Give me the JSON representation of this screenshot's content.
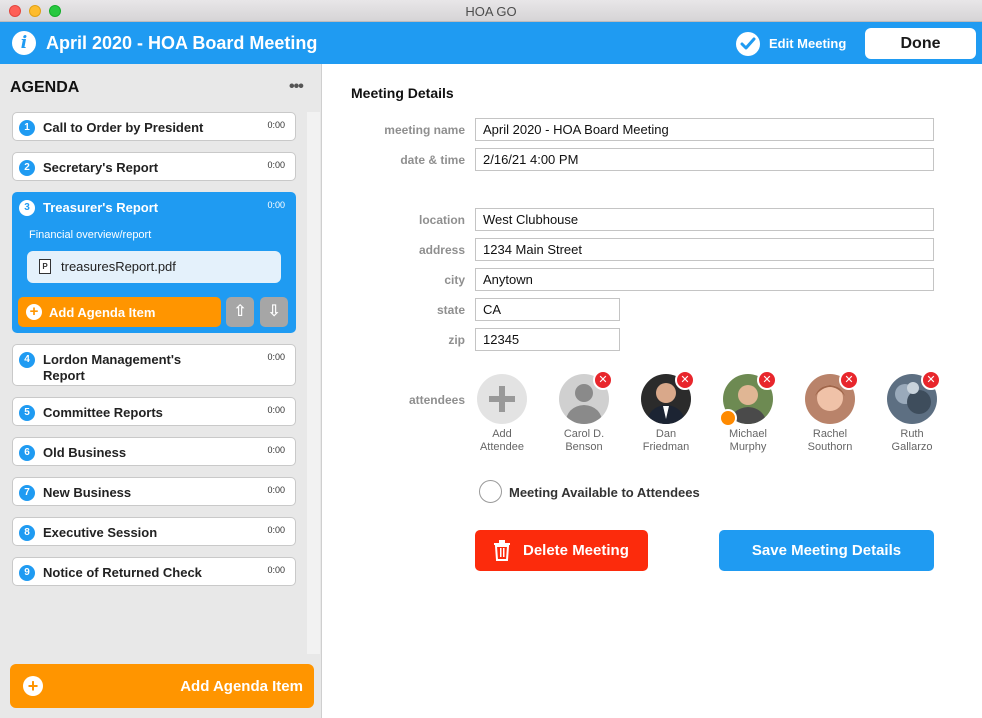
{
  "window": {
    "title": "HOA GO"
  },
  "header": {
    "title": "April 2020 - HOA Board Meeting",
    "edit_label": "Edit Meeting",
    "done_label": "Done",
    "accent": "#1f9bf2"
  },
  "sidebar": {
    "heading": "AGENDA",
    "items": [
      {
        "num": "1",
        "label": "Call to Order by President",
        "duration": "0:00"
      },
      {
        "num": "2",
        "label": "Secretary's Report",
        "duration": "0:00"
      },
      {
        "num": "3",
        "label": "Treasurer's Report",
        "duration": "0:00",
        "description": "Financial overview/report",
        "attachment": "treasuresReport.pdf",
        "add_label": "Add Agenda Item"
      },
      {
        "num": "4",
        "label": "Lordon Management's Report",
        "duration": "0:00"
      },
      {
        "num": "5",
        "label": "Committee Reports",
        "duration": "0:00"
      },
      {
        "num": "6",
        "label": "Old Business",
        "duration": "0:00"
      },
      {
        "num": "7",
        "label": "New Business",
        "duration": "0:00"
      },
      {
        "num": "8",
        "label": "Executive Session",
        "duration": "0:00"
      },
      {
        "num": "9",
        "label": "Notice of Returned Check",
        "duration": "0:00"
      }
    ],
    "add_button": "Add Agenda Item",
    "add_color": "#ff9500"
  },
  "details": {
    "heading": "Meeting Details",
    "fields": {
      "meeting_name": {
        "label": "meeting name",
        "value": "April 2020 - HOA Board Meeting"
      },
      "date_time": {
        "label": "date & time",
        "value": "2/16/21 4:00 PM"
      },
      "location": {
        "label": "location",
        "value": "West Clubhouse"
      },
      "address": {
        "label": "address",
        "value": "1234 Main Street"
      },
      "city": {
        "label": "city",
        "value": "Anytown"
      },
      "state": {
        "label": "state",
        "value": "CA"
      },
      "zip": {
        "label": "zip",
        "value": "12345"
      }
    },
    "attendees_label": "attendees",
    "add_attendee": {
      "line1": "Add",
      "line2": "Attendee"
    },
    "attendees": [
      {
        "first": "Carol D.",
        "last": "Benson"
      },
      {
        "first": "Dan",
        "last": "Friedman"
      },
      {
        "first": "Michael",
        "last": "Murphy"
      },
      {
        "first": "Rachel",
        "last": "Southorn"
      },
      {
        "first": "Ruth",
        "last": "Gallarzo"
      }
    ],
    "available_label": "Meeting Available to Attendees",
    "delete_label": "Delete Meeting",
    "save_label": "Save Meeting Details",
    "delete_color": "#fc2b0c"
  }
}
